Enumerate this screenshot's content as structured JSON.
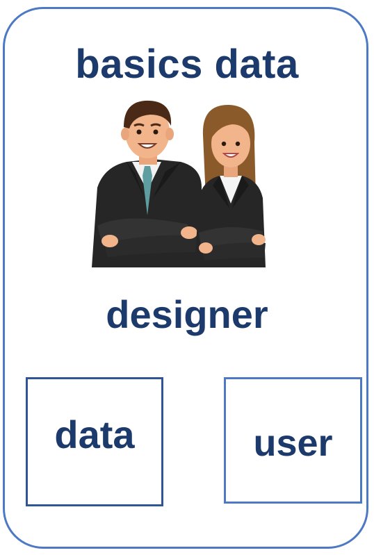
{
  "title": "basics data",
  "role_label": "designer",
  "boxes": {
    "left_label": "data",
    "right_label": "user"
  },
  "illustration": {
    "subject": "two-business-people-icon",
    "colors": {
      "outline": "#4d79c4",
      "text": "#1c3a6b",
      "suit": "#262626",
      "skin": "#f2b48a",
      "hair_man": "#4a2a17",
      "hair_woman": "#8b5a2b",
      "tie": "#5f9ea0"
    }
  }
}
